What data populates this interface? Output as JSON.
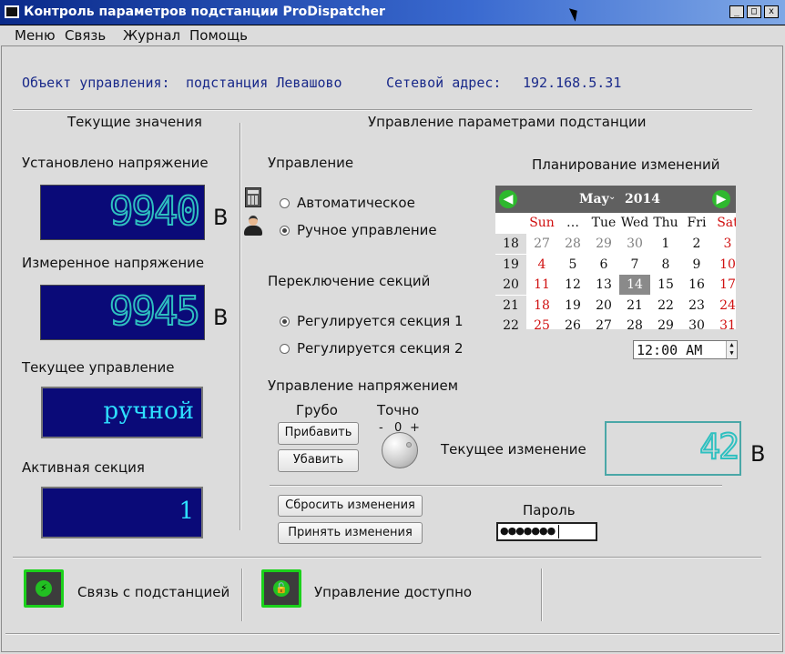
{
  "window": {
    "title": "Контроль параметров подстанции ProDispatcher",
    "minimize": "_",
    "maximize": "□",
    "close": "x"
  },
  "menu": [
    "Меню",
    "Связь",
    "Журнал",
    "Помощь"
  ],
  "info": {
    "object_label": "Объект управления:",
    "object_value": "подстанция Левашово",
    "address_label": "Сетевой адрес:",
    "address_value": "192.168.5.31"
  },
  "left": {
    "title": "Текущие значения",
    "set_voltage_label": "Установлено напряжение",
    "set_voltage_value": "9940",
    "measured_voltage_label": "Измеренное напряжение",
    "measured_voltage_value": "9945",
    "voltage_unit": "В",
    "current_control_label": "Текущее управление",
    "current_control_value": "ручной",
    "active_section_label": "Активная секция",
    "active_section_value": "1"
  },
  "right": {
    "title": "Управление параметрами подстанции",
    "control_label": "Управление",
    "auto_option": "Автоматическое",
    "manual_option": "Ручное управление",
    "selected_mode": "manual",
    "section_switch_label": "Переключение секций",
    "section1_option": "Регулируется секция 1",
    "section2_option": "Регулируется секция 2",
    "selected_section": "1",
    "planning_label": "Планирование изменений",
    "voltage_control_label": "Управление напряжением",
    "coarse_label": "Грубо",
    "fine_label": "Точно",
    "add_button": "Прибавить",
    "sub_button": "Убавить",
    "knob_minus": "-",
    "knob_zero": "0",
    "knob_plus": "+",
    "current_change_label": "Текущее изменение",
    "current_change_value": "42",
    "change_unit": "В",
    "reset_button": "Сбросить изменения",
    "apply_button": "Принять изменения",
    "password_label": "Пароль",
    "password_dots": "●●●●●●●"
  },
  "calendar": {
    "month": "May",
    "year": "2014",
    "headers": [
      "Sun",
      "…",
      "Tue",
      "Wed",
      "Thu",
      "Fri",
      "Sat"
    ],
    "weeks": [
      {
        "num": "18",
        "days": [
          "27",
          "28",
          "29",
          "30",
          "1",
          "2",
          "3"
        ]
      },
      {
        "num": "19",
        "days": [
          "4",
          "5",
          "6",
          "7",
          "8",
          "9",
          "10"
        ]
      },
      {
        "num": "20",
        "days": [
          "11",
          "12",
          "13",
          "14",
          "15",
          "16",
          "17"
        ]
      },
      {
        "num": "21",
        "days": [
          "18",
          "19",
          "20",
          "21",
          "22",
          "23",
          "24"
        ]
      },
      {
        "num": "22",
        "days": [
          "25",
          "26",
          "27",
          "28",
          "29",
          "30",
          "31"
        ]
      }
    ],
    "selected_day": "14",
    "time": "12:00 AM"
  },
  "status": {
    "connection_label": "Связь с подстанцией",
    "control_label": "Управление доступно"
  },
  "colors": {
    "lcd_bg": "#0a0a78",
    "lcd_digit": "#2ec0c0",
    "accent_green": "#1bd11b",
    "info_blue": "#1a2a8a"
  }
}
